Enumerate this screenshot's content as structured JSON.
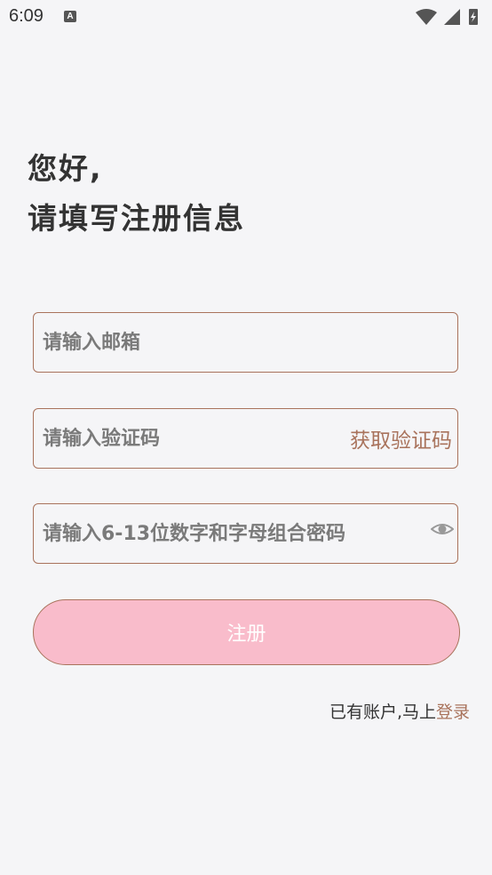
{
  "status_bar": {
    "time": "6:09",
    "notification_icon": "A"
  },
  "greeting": {
    "line1": "您好,",
    "line2": "请填写注册信息"
  },
  "email": {
    "placeholder": "请输入邮箱",
    "value": ""
  },
  "code": {
    "placeholder": "请输入验证码",
    "value": "",
    "get_code_label": "获取验证码"
  },
  "password": {
    "placeholder": "请输入6-13位数字和字母组合密码",
    "value": "",
    "toggle_icon": "eye-icon"
  },
  "register_button": {
    "label": "注册"
  },
  "login_prompt": {
    "text": "已有账户,马上",
    "link": "登录"
  },
  "colors": {
    "accent": "#a9735c",
    "button_bg": "#f9bccb",
    "background": "#f5f5f7"
  }
}
